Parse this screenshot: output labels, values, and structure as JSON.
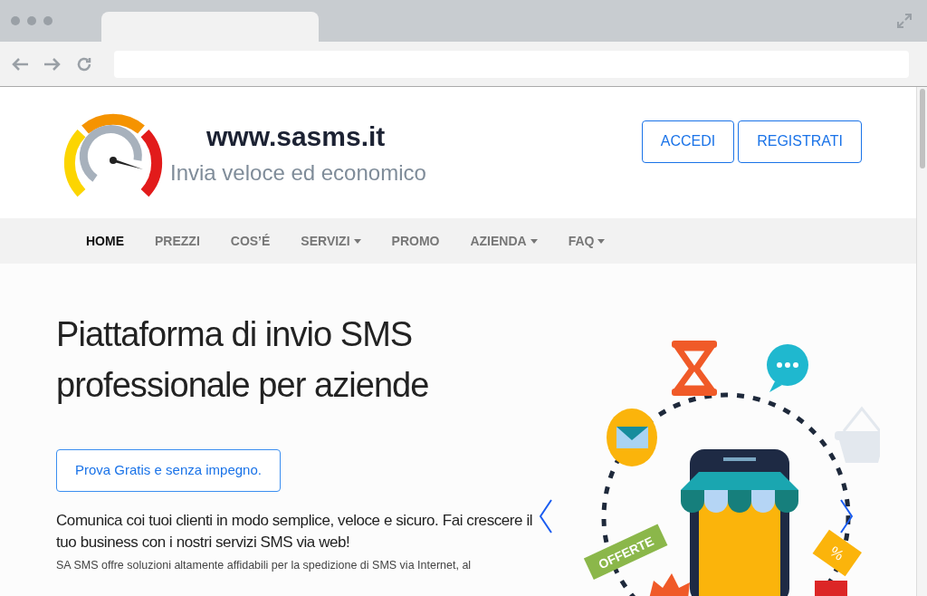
{
  "logo": {
    "site": "www.sasms.it",
    "tagline": "Invia veloce ed economico"
  },
  "header_buttons": [
    "ACCEDI",
    "REGISTRATI"
  ],
  "nav": [
    {
      "label": "HOME",
      "selected": true,
      "dropdown": false
    },
    {
      "label": "PREZZI",
      "selected": false,
      "dropdown": false
    },
    {
      "label": "COS’É",
      "selected": false,
      "dropdown": false
    },
    {
      "label": "SERVIZI",
      "selected": false,
      "dropdown": true
    },
    {
      "label": "PROMO",
      "selected": false,
      "dropdown": false
    },
    {
      "label": "AZIENDA",
      "selected": false,
      "dropdown": true
    },
    {
      "label": "FAQ",
      "selected": false,
      "dropdown": true
    }
  ],
  "hero": {
    "title": "Piattaforma di invio SMS professionale per aziende",
    "cta": "Prova Gratis e senza impegno.",
    "subtitle": "Comunica coi tuoi clienti in modo semplice, veloce e sicuro. Fai crescere il tuo business con i nostri servizi SMS via web!",
    "body": "SA SMS offre soluzioni altamente affidabili per la spedizione di SMS via Internet, al"
  },
  "illustration": {
    "ribbon": "OFFERTE",
    "tag": "%"
  }
}
